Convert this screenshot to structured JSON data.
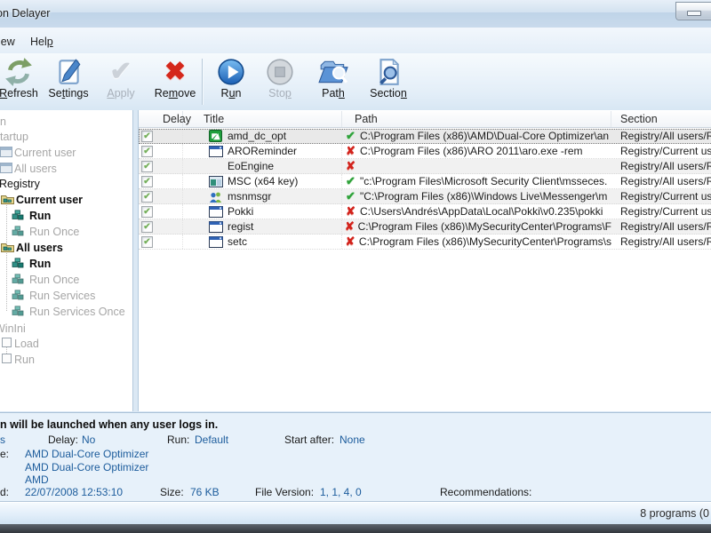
{
  "window": {
    "title": "on Delayer"
  },
  "menu": {
    "items": [
      {
        "label": "iew"
      },
      {
        "pre": "Hel",
        "u": "p",
        "post": ""
      }
    ]
  },
  "toolbar": {
    "buttons": [
      {
        "pre": "",
        "u": "R",
        "post": "efresh",
        "enabled": true,
        "icon": "refresh-icon"
      },
      {
        "pre": "Se",
        "u": "t",
        "post": "tings",
        "enabled": true,
        "icon": "settings-icon"
      },
      {
        "pre": "",
        "u": "A",
        "post": "pply",
        "enabled": false,
        "icon": "apply-icon"
      },
      {
        "pre": "Re",
        "u": "m",
        "post": "ove",
        "enabled": true,
        "icon": "remove-icon"
      },
      {
        "pre": "R",
        "u": "u",
        "post": "n",
        "enabled": true,
        "icon": "run-icon"
      },
      {
        "pre": "Sto",
        "u": "p",
        "post": "",
        "enabled": false,
        "icon": "stop-icon"
      },
      {
        "pre": "Pat",
        "u": "h",
        "post": "",
        "enabled": true,
        "icon": "path-icon"
      },
      {
        "pre": "Sectio",
        "u": "n",
        "post": "",
        "enabled": true,
        "icon": "section-icon"
      }
    ]
  },
  "tree": {
    "items": [
      {
        "label": "n"
      },
      {
        "label": "tartup"
      },
      {
        "label": "Current user"
      },
      {
        "label": "All users"
      },
      {
        "label": "Registry"
      },
      {
        "label": "Current user"
      },
      {
        "label": "Run"
      },
      {
        "label": "Run Once"
      },
      {
        "label": "All users"
      },
      {
        "label": "Run"
      },
      {
        "label": "Run Once"
      },
      {
        "label": "Run Services"
      },
      {
        "label": "Run Services Once"
      },
      {
        "label": "WinIni"
      },
      {
        "label": "Load"
      },
      {
        "label": "Run"
      }
    ]
  },
  "table": {
    "headers": {
      "delay": "Delay",
      "title": "Title",
      "path": "Path",
      "section": "Section"
    },
    "rows": [
      {
        "checked": true,
        "icon": "amd-icon",
        "title": "amd_dc_opt",
        "path_found": true,
        "path": "C:\\Program Files (x86)\\AMD\\Dual-Core Optimizer\\an",
        "section": "Registry/All users/Ru"
      },
      {
        "checked": true,
        "icon": "window-icon",
        "title": "AROReminder",
        "path_found": false,
        "path": "C:\\Program Files (x86)\\ARO 2011\\aro.exe -rem",
        "section": "Registry/Current us"
      },
      {
        "checked": true,
        "icon": "none",
        "title": "EoEngine",
        "path_found": false,
        "path": "",
        "section": "Registry/All users/Ru"
      },
      {
        "checked": true,
        "icon": "monitor-icon",
        "title": "MSC (x64 key)",
        "path_found": true,
        "path": "\"c:\\Program Files\\Microsoft Security Client\\msseces.",
        "section": "Registry/All users/Ru"
      },
      {
        "checked": true,
        "icon": "people-icon",
        "title": "msnmsgr",
        "path_found": true,
        "path": "\"C:\\Program Files (x86)\\Windows Live\\Messenger\\m",
        "section": "Registry/Current us"
      },
      {
        "checked": true,
        "icon": "window-icon",
        "title": "Pokki",
        "path_found": false,
        "path": "C:\\Users\\Andrés\\AppData\\Local\\Pokki\\v0.235\\pokki",
        "section": "Registry/Current us"
      },
      {
        "checked": true,
        "icon": "window-icon",
        "title": "regist",
        "path_found": false,
        "path": "C:\\Program Files (x86)\\MySecurityCenter\\Programs\\F",
        "section": "Registry/All users/Ru"
      },
      {
        "checked": true,
        "icon": "window-icon",
        "title": "setc",
        "path_found": false,
        "path": "C:\\Program Files (x86)\\MySecurityCenter\\Programs\\s",
        "section": "Registry/All users/Ru"
      }
    ]
  },
  "details": {
    "headline": "n will be launched when any user logs in.",
    "left_fragment": "s",
    "delay_label": "Delay:",
    "delay_value": "No",
    "run_label": "Run:",
    "run_value": "Default",
    "start_after_label": "Start after:",
    "start_after_value": "None",
    "name_label_fragment": "e:",
    "name_value_1": "AMD Dual-Core Optimizer",
    "name_value_2": "AMD Dual-Core Optimizer",
    "name_value_3": "AMD",
    "date_label_fragment": "d:",
    "date_value": "22/07/2008 12:53:10",
    "size_label": "Size:",
    "size_value": "76 KB",
    "file_version_label": "File Version:",
    "file_version_value": "1, 1, 4, 0",
    "recommendations_label": "Recommendations:"
  },
  "status_bar": {
    "count_text": "8 programs (0"
  },
  "colors": {
    "accent_value_blue": "#1c5c9c",
    "ok_green": "#2fa23b",
    "missing_red": "#d2231c",
    "disabled_text": "#a8b0ba"
  }
}
